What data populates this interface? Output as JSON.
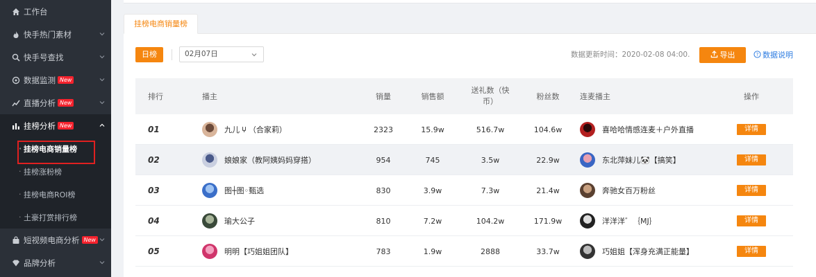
{
  "sidebar": {
    "items": [
      {
        "label": "工作台",
        "icon": "home-icon",
        "badge": "",
        "chevron": false
      },
      {
        "label": "快手热门素材",
        "icon": "fire-icon",
        "badge": "",
        "chevron": true
      },
      {
        "label": "快手号查找",
        "icon": "search-icon",
        "badge": "",
        "chevron": true
      },
      {
        "label": "数据监测",
        "icon": "monitor-icon",
        "badge": "New",
        "chevron": true
      },
      {
        "label": "直播分析",
        "icon": "trend-icon",
        "badge": "New",
        "chevron": true
      },
      {
        "label": "挂榜分析",
        "icon": "bar-chart-icon",
        "badge": "New",
        "chevron": true
      }
    ],
    "sub_items": [
      {
        "label": "挂榜电商销量榜"
      },
      {
        "label": "挂榜涨粉榜"
      },
      {
        "label": "挂榜电商ROI榜"
      },
      {
        "label": "土豪打赏排行榜"
      }
    ],
    "bottom_items": [
      {
        "label": "短视频电商分析",
        "icon": "bag-icon",
        "badge": "New"
      },
      {
        "label": "品牌分析",
        "icon": "diamond-icon",
        "badge": ""
      }
    ]
  },
  "tab": {
    "label": "挂榜电商销量榜"
  },
  "toolbar": {
    "day_label": "日榜",
    "date_value": "02月07日",
    "update_time": "数据更新时间：2020-02-08 04:00.",
    "export_label": "导出",
    "help_label": "数据说明"
  },
  "table": {
    "headers": {
      "rank": "排行",
      "anchor": "播主",
      "sales": "销量",
      "revenue": "销售额",
      "gifts_line1": "送礼数（快",
      "gifts_line2": "币）",
      "fans": "粉丝数",
      "linked": "连麦播主",
      "action": "操作"
    },
    "rows": [
      {
        "rank": "01",
        "name": "九儿 🝘 （合家莉）",
        "sales": "2323",
        "revenue": "15.9w",
        "gifts": "516.7w",
        "fans": "104.6w",
        "linked": "喜哈哈情感连麦＋户外直播",
        "action": "详情"
      },
      {
        "rank": "02",
        "name": "娘娘家（教阿姨妈妈穿搭）",
        "sales": "954",
        "revenue": "745",
        "gifts": "3.5w",
        "fans": "22.9w",
        "linked": "东北萍妹儿🐼【搞笑】",
        "action": "详情"
      },
      {
        "rank": "03",
        "name": "图┼图◦甄选",
        "sales": "830",
        "revenue": "3.9w",
        "gifts": "7.3w",
        "fans": "21.4w",
        "linked": "奔驰女百万粉丝",
        "action": "详情"
      },
      {
        "rank": "04",
        "name": "瑜大公子",
        "sales": "810",
        "revenue": "7.2w",
        "gifts": "104.2w",
        "fans": "171.9w",
        "linked": "洋洋洋゛｛MJ｝",
        "action": "详情"
      },
      {
        "rank": "05",
        "name": "明明【巧姐姐团队】",
        "sales": "783",
        "revenue": "1.9w",
        "gifts": "2888",
        "fans": "33.7w",
        "linked": "巧姐姐【浑身充满正能量】",
        "action": "详情"
      }
    ]
  },
  "colors": {
    "accent": "#f5860f",
    "sidebar_bg": "#2b3038",
    "link": "#2f7de1",
    "highlight_box": "#e02020"
  }
}
